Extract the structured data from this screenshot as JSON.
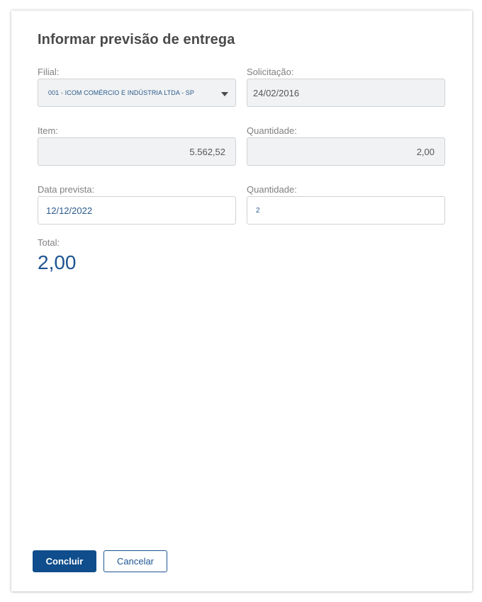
{
  "dialog": {
    "title": "Informar previsão de entrega"
  },
  "fields": {
    "filial": {
      "label": "Filial:",
      "value": "001 - ICOM COMÉRCIO E INDÚSTRIA LTDA - SP"
    },
    "solicitacao": {
      "label": "Solicitação:",
      "value": "24/02/2016"
    },
    "item": {
      "label": "Item:",
      "value": "5.562,52"
    },
    "quantidade_atual": {
      "label": "Quantidade:",
      "value": "2,00"
    },
    "data_prevista": {
      "label": "Data prevista:",
      "value": "12/12/2022"
    },
    "quantidade_prevista": {
      "label": "Quantidade:",
      "value": "2"
    }
  },
  "total": {
    "label": "Total:",
    "value": "2,00"
  },
  "actions": {
    "confirm_label": "Concluir",
    "cancel_label": "Cancelar"
  },
  "colors": {
    "primary": "#0f4d8c",
    "accent_text": "#1d5592",
    "readonly_bg": "#f1f2f3"
  }
}
